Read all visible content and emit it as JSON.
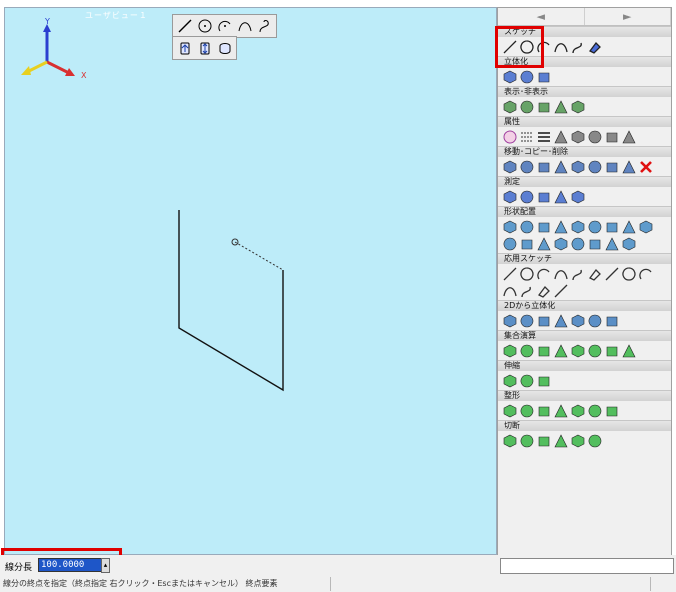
{
  "viewport": {
    "title": "ユーザビュー１",
    "axis_labels": {
      "x": "X",
      "y": "Y"
    }
  },
  "panel": {
    "nav": {
      "prev": "◄",
      "next": "►"
    },
    "sections": [
      {
        "id": "sketch",
        "label": "スケッチ",
        "icons": [
          "line-icon",
          "circle-icon",
          "arc-icon",
          "curve-icon",
          "spline-icon",
          "eraser-icon"
        ]
      },
      {
        "id": "solidify",
        "label": "立体化",
        "icons": [
          "extrude-icon",
          "extrude-both-icon",
          "revolve-icon"
        ]
      },
      {
        "id": "showhide",
        "label": "表示･非表示",
        "icons": [
          "view-icon",
          "layer-icon",
          "show-icon",
          "hide-icon",
          "toggle-icon"
        ]
      },
      {
        "id": "attribute",
        "label": "属性",
        "icons": [
          "color-icon",
          "line-style-icon",
          "line-width-icon",
          "face-icon",
          "cube-icon",
          "layer-stack-icon",
          "material-icon",
          "texture-icon"
        ]
      },
      {
        "id": "move",
        "label": "移動･コピー･削除",
        "icons": [
          "move-icon",
          "rotate-icon",
          "mirror-icon",
          "copy-icon",
          "copy-move-icon",
          "rotate-copy-icon",
          "mirror-copy-icon",
          "scale-icon",
          "delete-icon"
        ]
      },
      {
        "id": "measure",
        "label": "測定",
        "icons": [
          "measure-point-icon",
          "measure-distance-icon",
          "measure-length-icon",
          "measure-angle-icon",
          "measure-volume-icon"
        ]
      },
      {
        "id": "shape",
        "label": "形状配置",
        "icons": [
          "cylinder-icon",
          "prism-icon",
          "box-icon",
          "cone-icon",
          "pyramid-icon",
          "torus-icon",
          "sphere-icon",
          "hemisphere-icon",
          "capsule-icon",
          "ring-icon",
          "bolt-icon",
          "gear-icon",
          "pipe-icon",
          "hole-icon",
          "fillet-icon",
          "chamfer-icon",
          "tube-icon"
        ]
      },
      {
        "id": "applied",
        "label": "応用スケッチ",
        "icons": [
          "offset-icon",
          "trim-icon",
          "extend-icon",
          "rect-icon",
          "pattern-icon",
          "point-icon",
          "polygon-icon",
          "divide-icon",
          "snap-icon",
          "bend-icon",
          "tangent-icon",
          "project-icon",
          "wrap-icon"
        ]
      },
      {
        "id": "from2d",
        "label": "2Dから立体化",
        "icons": [
          "lift-icon",
          "sweep-icon",
          "loft-icon",
          "shell-icon",
          "taper-icon",
          "draft-icon",
          "thread-icon"
        ]
      },
      {
        "id": "boolean",
        "label": "集合演算",
        "icons": [
          "union-icon",
          "subtract-icon",
          "intersect-icon",
          "split-icon",
          "merge-icon",
          "cut-icon",
          "combine-icon",
          "explode-icon"
        ]
      },
      {
        "id": "stretch",
        "label": "伸縮",
        "icons": [
          "stretch-up-icon",
          "stretch-side-icon",
          "stretch-face-icon"
        ]
      },
      {
        "id": "modify",
        "label": "整形",
        "icons": [
          "round-edge-icon",
          "bevel-icon",
          "chamfer-face-icon",
          "smooth-icon",
          "flatten-icon",
          "sharpen-icon",
          "deform-icon"
        ]
      },
      {
        "id": "section",
        "label": "切断",
        "icons": [
          "cut-plane-icon",
          "slice-icon",
          "cut-line-icon",
          "section-icon",
          "cut-solid-icon",
          "separate-icon"
        ]
      }
    ]
  },
  "status": {
    "length_label": "線分長",
    "length_value": "100.0000",
    "message": "線分の終点を指定（終点指定 右クリック・Escまたはキャンセル） 終点要素"
  },
  "colors": {
    "viewport_bg": "#bdecf9",
    "highlight": "#e00000",
    "axis_x": "#d83030",
    "axis_y": "#2a3fd0",
    "axis_z": "#e8d020",
    "input_bg": "#1e56c8"
  }
}
